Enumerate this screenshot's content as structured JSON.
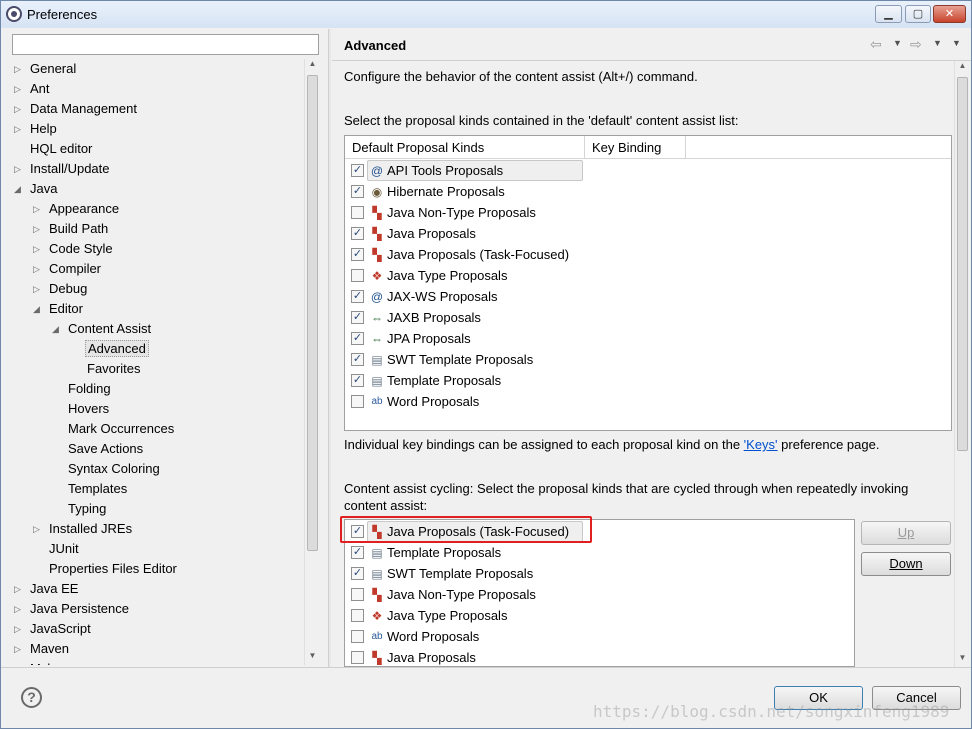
{
  "window": {
    "title": "Preferences",
    "controls": {
      "minimize": "▁",
      "maximize": "▢",
      "close": "✕"
    }
  },
  "left": {
    "filter": {
      "value": "",
      "placeholder": ""
    },
    "tree": [
      {
        "label": "General",
        "level": 0,
        "arrow": "▷"
      },
      {
        "label": "Ant",
        "level": 0,
        "arrow": "▷"
      },
      {
        "label": "Data Management",
        "level": 0,
        "arrow": "▷"
      },
      {
        "label": "Help",
        "level": 0,
        "arrow": "▷"
      },
      {
        "label": "HQL editor",
        "level": 0,
        "arrow": ""
      },
      {
        "label": "Install/Update",
        "level": 0,
        "arrow": "▷"
      },
      {
        "label": "Java",
        "level": 0,
        "arrow": "◢"
      },
      {
        "label": "Appearance",
        "level": 1,
        "arrow": "▷"
      },
      {
        "label": "Build Path",
        "level": 1,
        "arrow": "▷"
      },
      {
        "label": "Code Style",
        "level": 1,
        "arrow": "▷"
      },
      {
        "label": "Compiler",
        "level": 1,
        "arrow": "▷"
      },
      {
        "label": "Debug",
        "level": 1,
        "arrow": "▷"
      },
      {
        "label": "Editor",
        "level": 1,
        "arrow": "◢"
      },
      {
        "label": "Content Assist",
        "level": 2,
        "arrow": "◢"
      },
      {
        "label": "Advanced",
        "level": 3,
        "arrow": "",
        "selected": true
      },
      {
        "label": "Favorites",
        "level": 3,
        "arrow": ""
      },
      {
        "label": "Folding",
        "level": 2,
        "arrow": ""
      },
      {
        "label": "Hovers",
        "level": 2,
        "arrow": ""
      },
      {
        "label": "Mark Occurrences",
        "level": 2,
        "arrow": ""
      },
      {
        "label": "Save Actions",
        "level": 2,
        "arrow": ""
      },
      {
        "label": "Syntax Coloring",
        "level": 2,
        "arrow": ""
      },
      {
        "label": "Templates",
        "level": 2,
        "arrow": ""
      },
      {
        "label": "Typing",
        "level": 2,
        "arrow": ""
      },
      {
        "label": "Installed JREs",
        "level": 1,
        "arrow": "▷"
      },
      {
        "label": "JUnit",
        "level": 1,
        "arrow": ""
      },
      {
        "label": "Properties Files Editor",
        "level": 1,
        "arrow": ""
      },
      {
        "label": "Java EE",
        "level": 0,
        "arrow": "▷"
      },
      {
        "label": "Java Persistence",
        "level": 0,
        "arrow": "▷"
      },
      {
        "label": "JavaScript",
        "level": 0,
        "arrow": "▷"
      },
      {
        "label": "Maven",
        "level": 0,
        "arrow": "▷"
      },
      {
        "label": "Myl...",
        "level": 0,
        "arrow": "▷"
      }
    ]
  },
  "right": {
    "page_title": "Advanced",
    "nav": {
      "back": "⇦",
      "forward": "⇨",
      "dropdown": "▼"
    },
    "description": "Configure the behavior of the content assist (Alt+/) command.",
    "default_list_label": "Select the proposal kinds contained in the 'default' content assist list:",
    "columns": [
      "Default Proposal Kinds",
      "Key Binding"
    ],
    "default_proposals": [
      {
        "label": "API Tools Proposals",
        "checked": true,
        "icon": "api-tools-icon",
        "glyph": "@"
      },
      {
        "label": "Hibernate Proposals",
        "checked": true,
        "icon": "hibernate-icon",
        "glyph": "◉"
      },
      {
        "label": "Java Non-Type Proposals",
        "checked": false,
        "icon": "java-non-type-icon",
        "glyph": "▚"
      },
      {
        "label": "Java Proposals",
        "checked": true,
        "icon": "java-proposals-icon",
        "glyph": "▚"
      },
      {
        "label": "Java Proposals (Task-Focused)",
        "checked": true,
        "icon": "java-task-focused-icon",
        "glyph": "▚"
      },
      {
        "label": "Java Type Proposals",
        "checked": false,
        "icon": "java-type-icon",
        "glyph": "❖"
      },
      {
        "label": "JAX-WS Proposals",
        "checked": true,
        "icon": "jax-ws-icon",
        "glyph": "@"
      },
      {
        "label": "JAXB Proposals",
        "checked": true,
        "icon": "jaxb-icon",
        "glyph": "⇔"
      },
      {
        "label": "JPA Proposals",
        "checked": true,
        "icon": "jpa-icon",
        "glyph": "⇔"
      },
      {
        "label": "SWT Template Proposals",
        "checked": true,
        "icon": "swt-template-icon",
        "glyph": "▤"
      },
      {
        "label": "Template Proposals",
        "checked": true,
        "icon": "template-icon",
        "glyph": "▤"
      },
      {
        "label": "Word Proposals",
        "checked": false,
        "icon": "word-icon",
        "glyph": "ab"
      }
    ],
    "key_bindings_text_before": "Individual key bindings can be assigned to each proposal kind on the ",
    "keys_link": "'Keys'",
    "key_bindings_text_after": " preference page.",
    "cycling_label_line1": "Content assist cycling: Select the proposal kinds that are cycled through when repeatedly invoking",
    "cycling_label_line2": "content assist:",
    "cycling_proposals": [
      {
        "label": "Java Proposals (Task-Focused)",
        "checked": true,
        "icon": "java-task-focused-icon",
        "glyph": "▚"
      },
      {
        "label": "Template Proposals",
        "checked": true,
        "icon": "template-icon",
        "glyph": "▤"
      },
      {
        "label": "SWT Template Proposals",
        "checked": true,
        "icon": "swt-template-icon",
        "glyph": "▤"
      },
      {
        "label": "Java Non-Type Proposals",
        "checked": false,
        "icon": "java-non-type-icon",
        "glyph": "▚"
      },
      {
        "label": "Java Type Proposals",
        "checked": false,
        "icon": "java-type-icon",
        "glyph": "❖"
      },
      {
        "label": "Word Proposals",
        "checked": false,
        "icon": "word-icon",
        "glyph": "ab"
      },
      {
        "label": "Java Proposals",
        "checked": false,
        "icon": "java-proposals-icon",
        "glyph": "▚"
      }
    ],
    "up_label": "Up",
    "down_label": "Down"
  },
  "footer": {
    "help": "?",
    "ok": "OK",
    "cancel": "Cancel",
    "watermark": "https://blog.csdn.net/songxinfeng1989"
  },
  "colors": {
    "highlight": "#e02020",
    "link": "#0050d0",
    "selection": "#e5e5e5"
  }
}
